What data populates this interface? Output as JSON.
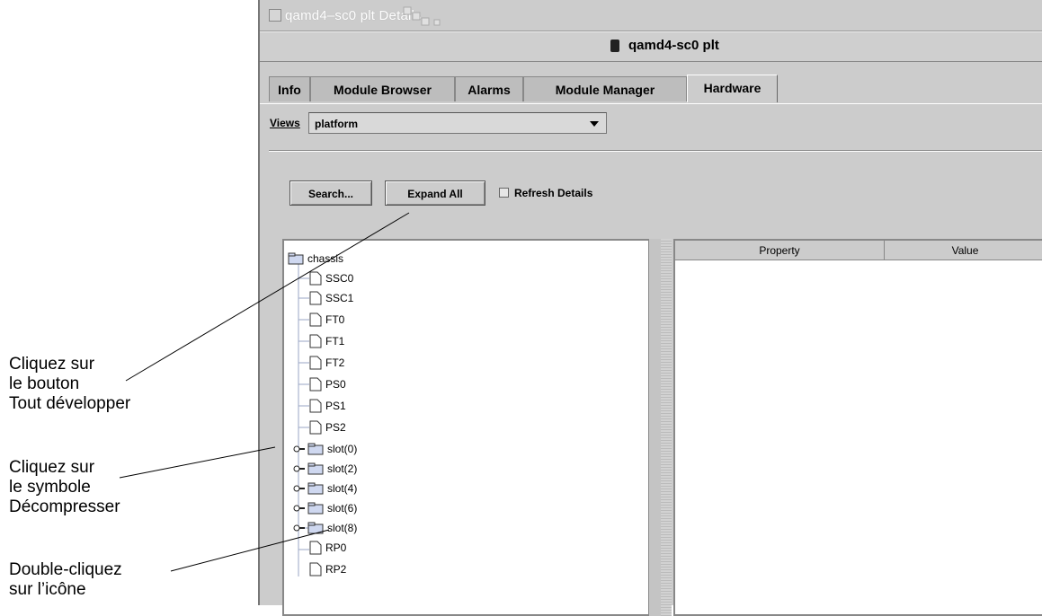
{
  "window": {
    "title": "qamd4–sc0 plt Details",
    "header_title": "qamd4-sc0 plt"
  },
  "tabs": [
    {
      "label": "Info",
      "active": false
    },
    {
      "label": "Module Browser",
      "active": false
    },
    {
      "label": "Alarms",
      "active": false
    },
    {
      "label": "Module Manager",
      "active": false
    },
    {
      "label": "Hardware",
      "active": true
    }
  ],
  "views": {
    "label": "Views",
    "selected": "platform"
  },
  "toolbar": {
    "search_label": "Search...",
    "expand_all_label": "Expand All",
    "refresh_label": "Refresh Details",
    "refresh_checked": false
  },
  "tree": {
    "root": "chassis",
    "children": [
      {
        "label": "SSC0",
        "type": "leaf"
      },
      {
        "label": "SSC1",
        "type": "leaf"
      },
      {
        "label": "FT0",
        "type": "leaf"
      },
      {
        "label": "FT1",
        "type": "leaf"
      },
      {
        "label": "FT2",
        "type": "leaf"
      },
      {
        "label": "PS0",
        "type": "leaf"
      },
      {
        "label": "PS1",
        "type": "leaf"
      },
      {
        "label": "PS2",
        "type": "leaf"
      },
      {
        "label": "slot(0)",
        "type": "folder"
      },
      {
        "label": "slot(2)",
        "type": "folder"
      },
      {
        "label": "slot(4)",
        "type": "folder"
      },
      {
        "label": "slot(6)",
        "type": "folder"
      },
      {
        "label": "slot(8)",
        "type": "folder"
      },
      {
        "label": "RP0",
        "type": "leaf"
      },
      {
        "label": "RP2",
        "type": "leaf"
      }
    ]
  },
  "properties_table": {
    "columns": [
      "Property",
      "Value"
    ]
  },
  "annotations": [
    {
      "lines": [
        "Cliquez sur",
        "le bouton",
        "Tout développer"
      ]
    },
    {
      "lines": [
        "Cliquez sur",
        "le symbole",
        "Décompresser"
      ]
    },
    {
      "lines": [
        "Double-cliquez",
        "sur l’icône"
      ]
    }
  ]
}
